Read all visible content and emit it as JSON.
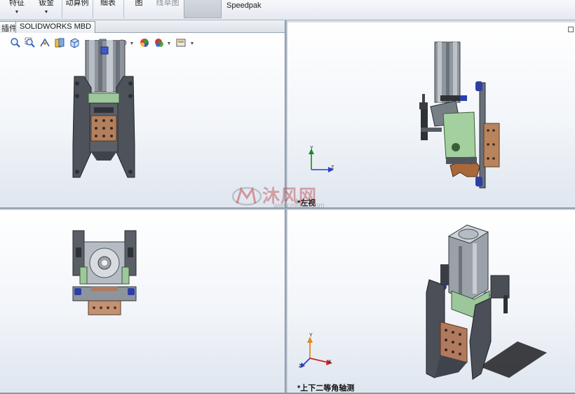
{
  "ribbon": {
    "items": [
      {
        "label": "特征"
      },
      {
        "label": "钣金"
      },
      {
        "label": "动算例"
      },
      {
        "label": "细表"
      },
      {
        "label": "图"
      },
      {
        "label": "线草图"
      }
    ],
    "speedpak_label": "Speedpak"
  },
  "tabs": [
    {
      "label": "插件"
    },
    {
      "label": "SOLIDWORKS MBD"
    }
  ],
  "hud_icons": [
    "zoom-to-fit-icon",
    "zoom-area-icon",
    "previous-view-icon",
    "section-view-icon",
    "view-orientation-icon",
    "display-style-icon",
    "hide-show-icon",
    "edit-appearance-icon",
    "apply-scene-icon",
    "view-settings-icon"
  ],
  "viewports": {
    "top_right": {
      "label": "*左视",
      "axes": {
        "y": "Y",
        "z": "Z"
      }
    },
    "bottom_right": {
      "label": "*上下二等角轴测",
      "axes": {
        "y": "Y",
        "x": "X",
        "z": "Z"
      }
    }
  },
  "watermark": {
    "text": "沐风网",
    "url": "www.mfcad.com"
  },
  "colors": {
    "ribbon_bg": "#e9edf2",
    "viewport_top": "#ffffff",
    "viewport_bottom": "#dfe6ef",
    "splitter": "#a7b2c1",
    "part_dark": "#4a4f58",
    "part_copper": "#b07a5e",
    "part_green": "#9cc79a",
    "part_blue": "#2c3fa8",
    "axis_y": "#1a8a1a",
    "axis_z": "#2a3fd0",
    "axis_x": "#d02020"
  }
}
